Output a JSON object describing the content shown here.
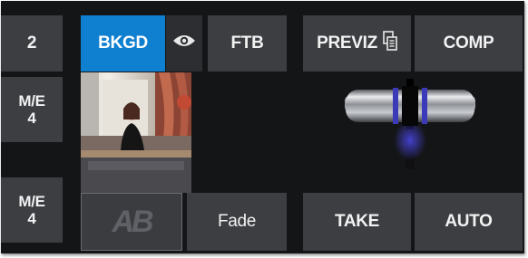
{
  "left_column": {
    "btn_2": "2",
    "me4_top_line1": "M/E",
    "me4_top_line2": "4",
    "me4_bottom_line1": "M/E",
    "me4_bottom_line2": "4"
  },
  "transition": {
    "bkgd": "BKGD",
    "ftb": "FTB",
    "ab_label": "AB",
    "fade": "Fade"
  },
  "actions": {
    "previz": "PREVIZ",
    "comp": "COMP",
    "take": "TAKE",
    "auto": "AUTO"
  },
  "icons": {
    "preview_eye": "eye-icon",
    "previz_copy": "copy-icon",
    "tbar": "t-bar-handle"
  },
  "colors": {
    "panel_bg": "#141517",
    "button_bg": "#3c3e42",
    "active_blue": "#0f7fd0",
    "tbar_glow": "#3d3bd0"
  }
}
